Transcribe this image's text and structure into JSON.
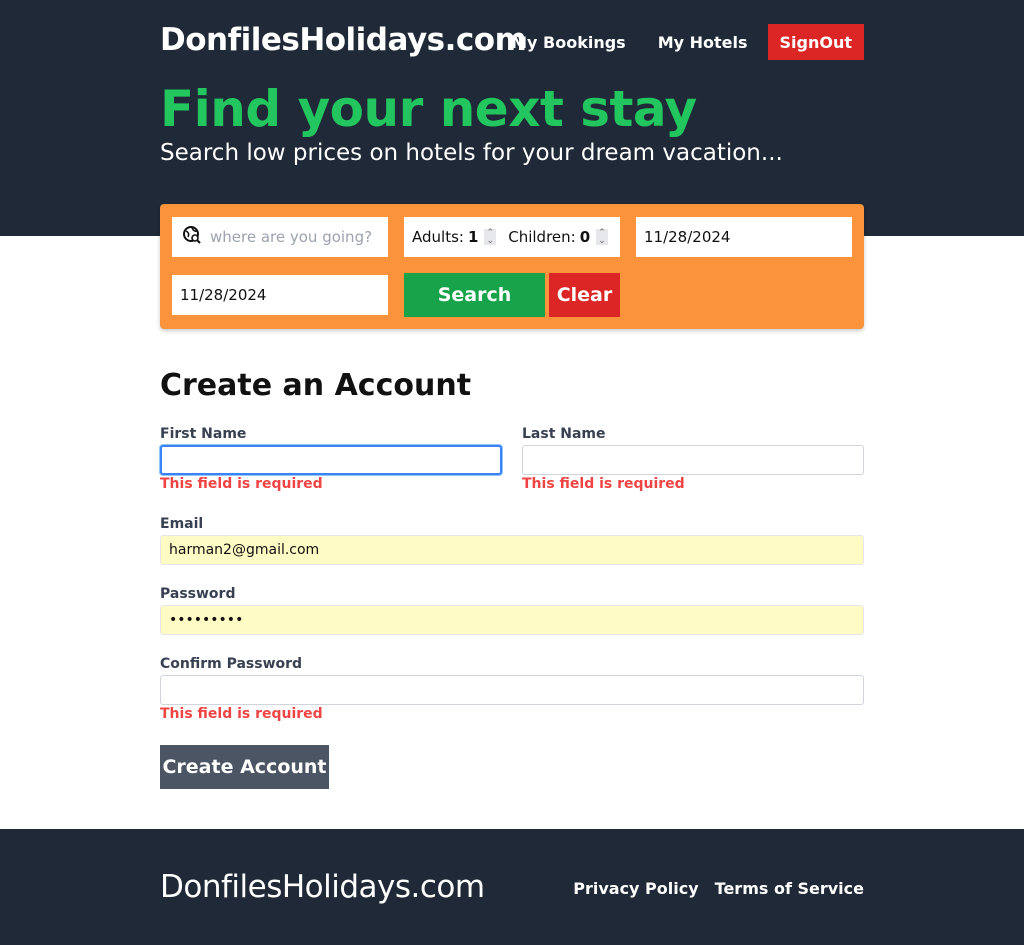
{
  "header": {
    "brand": "DonfilesHolidays.com",
    "nav": {
      "bookings": "My Bookings",
      "hotels": "My Hotels",
      "signout": "SignOut"
    },
    "headline": "Find your next stay",
    "subline": "Search low prices on hotels for your dream vacation..."
  },
  "search": {
    "destination_placeholder": "where are you going?",
    "adults_label": "Adults:",
    "adults_value": "1",
    "children_label": "Children:",
    "children_value": "0",
    "check_in": "11/28/2024",
    "check_out": "11/28/2024",
    "search_label": "Search",
    "clear_label": "Clear"
  },
  "form": {
    "title": "Create an Account",
    "first_name_label": "First Name",
    "first_name_value": "",
    "first_name_error": "This field is required",
    "last_name_label": "Last Name",
    "last_name_value": "",
    "last_name_error": "This field is required",
    "email_label": "Email",
    "email_value": "harman2@gmail.com",
    "password_label": "Password",
    "password_value": "•••••••••",
    "confirm_label": "Confirm Password",
    "confirm_value": "",
    "confirm_error": "This field is required",
    "submit_label": "Create Account"
  },
  "footer": {
    "brand": "DonfilesHolidays.com",
    "privacy": "Privacy Policy",
    "terms": "Terms of Service"
  },
  "colors": {
    "dark_bg": "#1f2937",
    "accent_green": "#22c55e",
    "search_orange": "#fb923c",
    "danger_red": "#dc2626",
    "button_gray": "#4b5563"
  }
}
